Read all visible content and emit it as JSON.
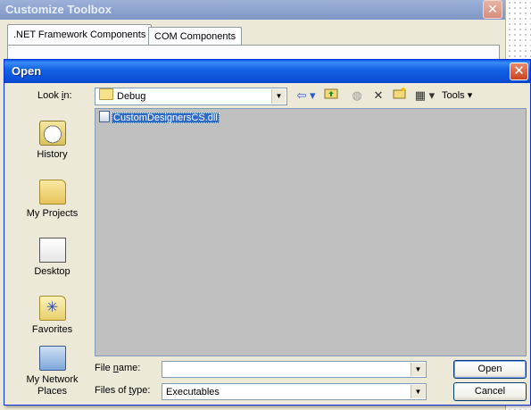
{
  "background_window": {
    "title": "Customize Toolbox",
    "close_glyph": "✕",
    "tabs": [
      {
        "label": ".NET Framework Components",
        "active": true
      },
      {
        "label": "COM Components",
        "active": false
      }
    ]
  },
  "dialog": {
    "title": "Open",
    "close_glyph": "✕",
    "look_in_label": "Look in:",
    "look_in_value": "Debug",
    "toolbar": {
      "back_icon": "back-arrow-icon",
      "up_icon": "up-folder-icon",
      "search_web_icon": "search-web-icon",
      "delete_icon": "delete-icon",
      "new_folder_icon": "new-folder-icon",
      "views_icon": "views-icon",
      "tools_label": "Tools"
    },
    "places": [
      {
        "label": "History",
        "icon": "history-icon"
      },
      {
        "label": "My Projects",
        "icon": "my-projects-icon"
      },
      {
        "label": "Desktop",
        "icon": "desktop-icon"
      },
      {
        "label": "Favorites",
        "icon": "favorites-icon"
      },
      {
        "label": "My Network Places",
        "icon": "network-places-icon"
      }
    ],
    "files": [
      {
        "name": "CustomDesignersCS.dll",
        "selected": true
      }
    ],
    "file_name_label": "File name:",
    "file_name_value": "",
    "files_of_type_label": "Files of type:",
    "files_of_type_value": "Executables",
    "open_button": "Open",
    "cancel_button": "Cancel"
  },
  "colors": {
    "titlebar_blue": "#0a5ee8",
    "selection_blue": "#316ac5",
    "list_background": "#c0c0c0",
    "dialog_face": "#ece9d8"
  }
}
